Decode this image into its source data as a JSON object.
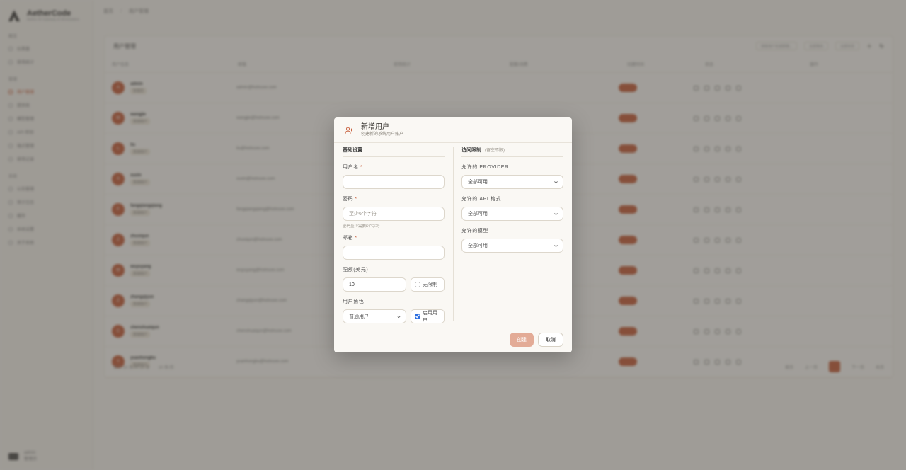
{
  "background": {
    "brand": {
      "name": "AetherCode",
      "subtitle": "Aether AI Gateway & Workstation"
    },
    "breadcrumb": [
      "首页",
      "用户管理"
    ],
    "nav": [
      {
        "group": "概览",
        "items": [
          "仪表盘",
          "使用统计"
        ]
      },
      {
        "group": "管理",
        "items": [
          "用户管理",
          "提供商",
          "模型管理",
          "API 密钥",
          "端点管理",
          "使用记录"
        ]
      },
      {
        "group": "系统",
        "items": [
          "公告管理",
          "审计日志",
          "缓存",
          "系统设置",
          "关于系统"
        ]
      }
    ],
    "active_nav": "用户管理",
    "card_title": "用户管理",
    "search_placeholder": "搜索用户名或邮箱...",
    "filters": [
      "全部角色",
      "全部状态"
    ],
    "columns": [
      "用户信息",
      "邮箱",
      "使用统计",
      "配额/消费",
      "创建时间",
      "状态",
      "操作"
    ],
    "rows": [
      {
        "initial": "A",
        "name": "admin",
        "role": "管理员",
        "email": "admin@hotnuxe.com"
      },
      {
        "initial": "W",
        "name": "wangjie",
        "role": "普通用户",
        "email": "wangjie@hotnuxe.com"
      },
      {
        "initial": "L",
        "name": "liu",
        "role": "普通用户",
        "email": "liu@hotnuxe.com"
      },
      {
        "initial": "X",
        "name": "xuxin",
        "role": "普通用户",
        "email": "xuxin@hotnuxe.com"
      },
      {
        "initial": "F",
        "name": "fangqiangqiang",
        "role": "普通用户",
        "email": "fangqiangqiang@hotnuxe.com"
      },
      {
        "initial": "Z",
        "name": "zhusiqun",
        "role": "普通用户",
        "email": "zhusiqun@hotnuxe.com"
      },
      {
        "initial": "W",
        "name": "wuyuyang",
        "role": "普通用户",
        "email": "wuyuyang@hotnuxe.com"
      },
      {
        "initial": "Z",
        "name": "zhangqiyun",
        "role": "普通用户",
        "email": "zhangqiyun@hotnuxe.com"
      },
      {
        "initial": "C",
        "name": "chenshuaiqun",
        "role": "普通用户",
        "email": "chenshuaiqun@hotnuxe.com"
      },
      {
        "initial": "Y",
        "name": "yuanhongbu",
        "role": "普通用户",
        "email": "yuanhongbu@hotnuxe.com"
      }
    ],
    "footer_summary": "显示 10 条/共 10 条",
    "page_size": "10 条/页",
    "pager": [
      "首页",
      "上一页",
      "1",
      "下一页",
      "末页"
    ],
    "user": {
      "name": "admin",
      "role": "管理员"
    }
  },
  "modal": {
    "title": "新增用户",
    "subtitle": "创建新的系统用户账户",
    "basic_section": "基础设置",
    "username_label": "用户名",
    "password_label": "密码",
    "password_placeholder": "至少6个字符",
    "password_helper": "密码至少需要6个字符",
    "email_label": "邮箱",
    "quota_label": "配额(美元)",
    "quota_value": "10",
    "unlimited_label": "无限制",
    "unlimited_checked": false,
    "role_label": "用户角色",
    "role_value": "普通用户",
    "enable_label": "启用用户",
    "enable_checked": true,
    "required_mark": "*",
    "access_section": "访问限制",
    "access_hint": "(留空不限)",
    "provider_label": "允许的 PROVIDER",
    "provider_value": "全部可用",
    "api_format_label": "允许的 API 格式",
    "api_format_value": "全部可用",
    "models_label": "允许的模型",
    "models_value": "全部可用",
    "create_button": "创建",
    "cancel_button": "取消"
  },
  "colors": {
    "accent": "#c96442",
    "accent_disabled": "#e3ab96",
    "background": "#faf8f4",
    "overlay": "rgba(60,56,50,0.48)"
  }
}
